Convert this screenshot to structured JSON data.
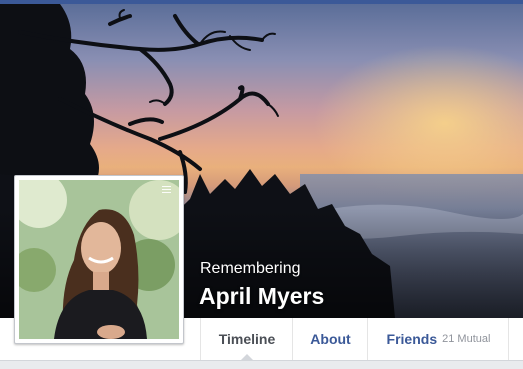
{
  "colors": {
    "brand": "#3b5998",
    "active_tab_text": "#4b4f56",
    "muted_text": "#90949c"
  },
  "profile": {
    "status_label": "Remembering",
    "name": "April Myers"
  },
  "tabs": [
    {
      "label": "Timeline",
      "active": true
    },
    {
      "label": "About",
      "active": false
    },
    {
      "label": "Friends",
      "extra": "21 Mutual",
      "active": false
    }
  ],
  "icons": {
    "profile_menu": "hamburger-menu-icon"
  }
}
